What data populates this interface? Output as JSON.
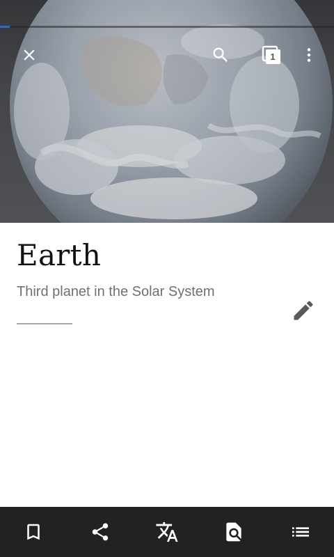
{
  "article": {
    "title": "Earth",
    "description": "Third planet in the Solar System",
    "hero_image": "earth-globe-image",
    "load_progress": 0.03
  },
  "toolbar": {
    "close_icon": "close-icon",
    "search_icon": "search-icon",
    "tabs_count": "1",
    "overflow_icon": "more-vert-icon"
  },
  "bottom_bar": {
    "actions": [
      "bookmark-icon",
      "share-icon",
      "translate-icon",
      "find-in-page-icon",
      "table-of-contents-icon"
    ]
  },
  "colors": {
    "progress": "#3366cc",
    "bottom_bar": "#222222",
    "divider": "#a2a9b1",
    "description": "#6f7073"
  }
}
